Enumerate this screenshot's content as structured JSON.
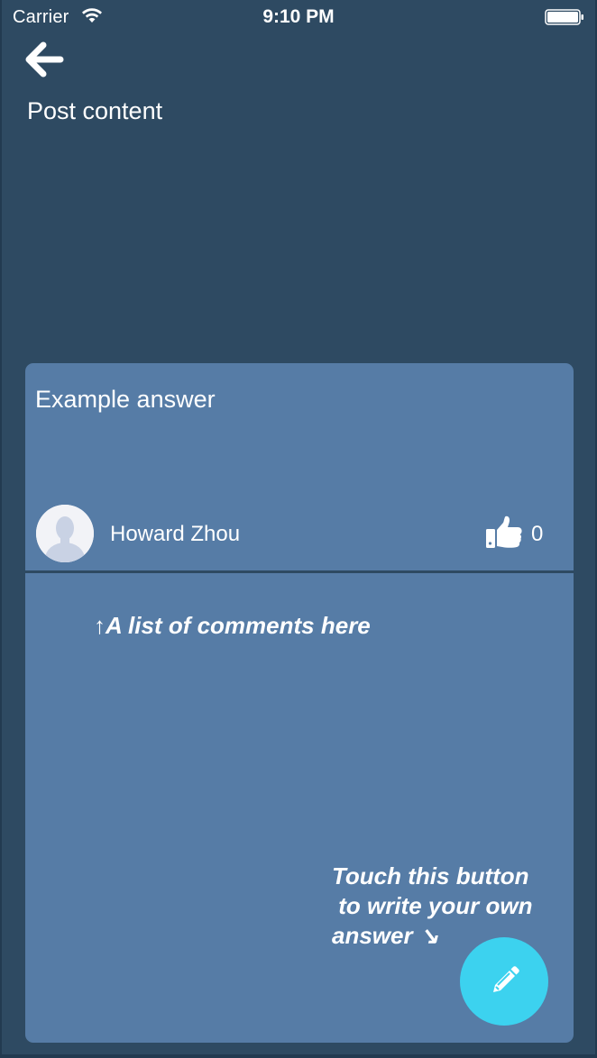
{
  "status_bar": {
    "carrier": "Carrier",
    "time": "9:10 PM"
  },
  "header": {
    "back_icon": "arrow-left-icon",
    "title": "Post content"
  },
  "answer": {
    "title": "Example answer",
    "author": "Howard Zhou",
    "like_icon": "thumbs-up-icon",
    "like_count": "0"
  },
  "comments": {
    "hint": "↑A list of comments here"
  },
  "fab": {
    "hint_lines": [
      "Touch this button",
      " to write your own",
      "answer ↘"
    ],
    "icon": "pencil-icon",
    "color": "#3cd2ef"
  },
  "colors": {
    "background": "#2e4a62",
    "card": "#567ca6"
  }
}
